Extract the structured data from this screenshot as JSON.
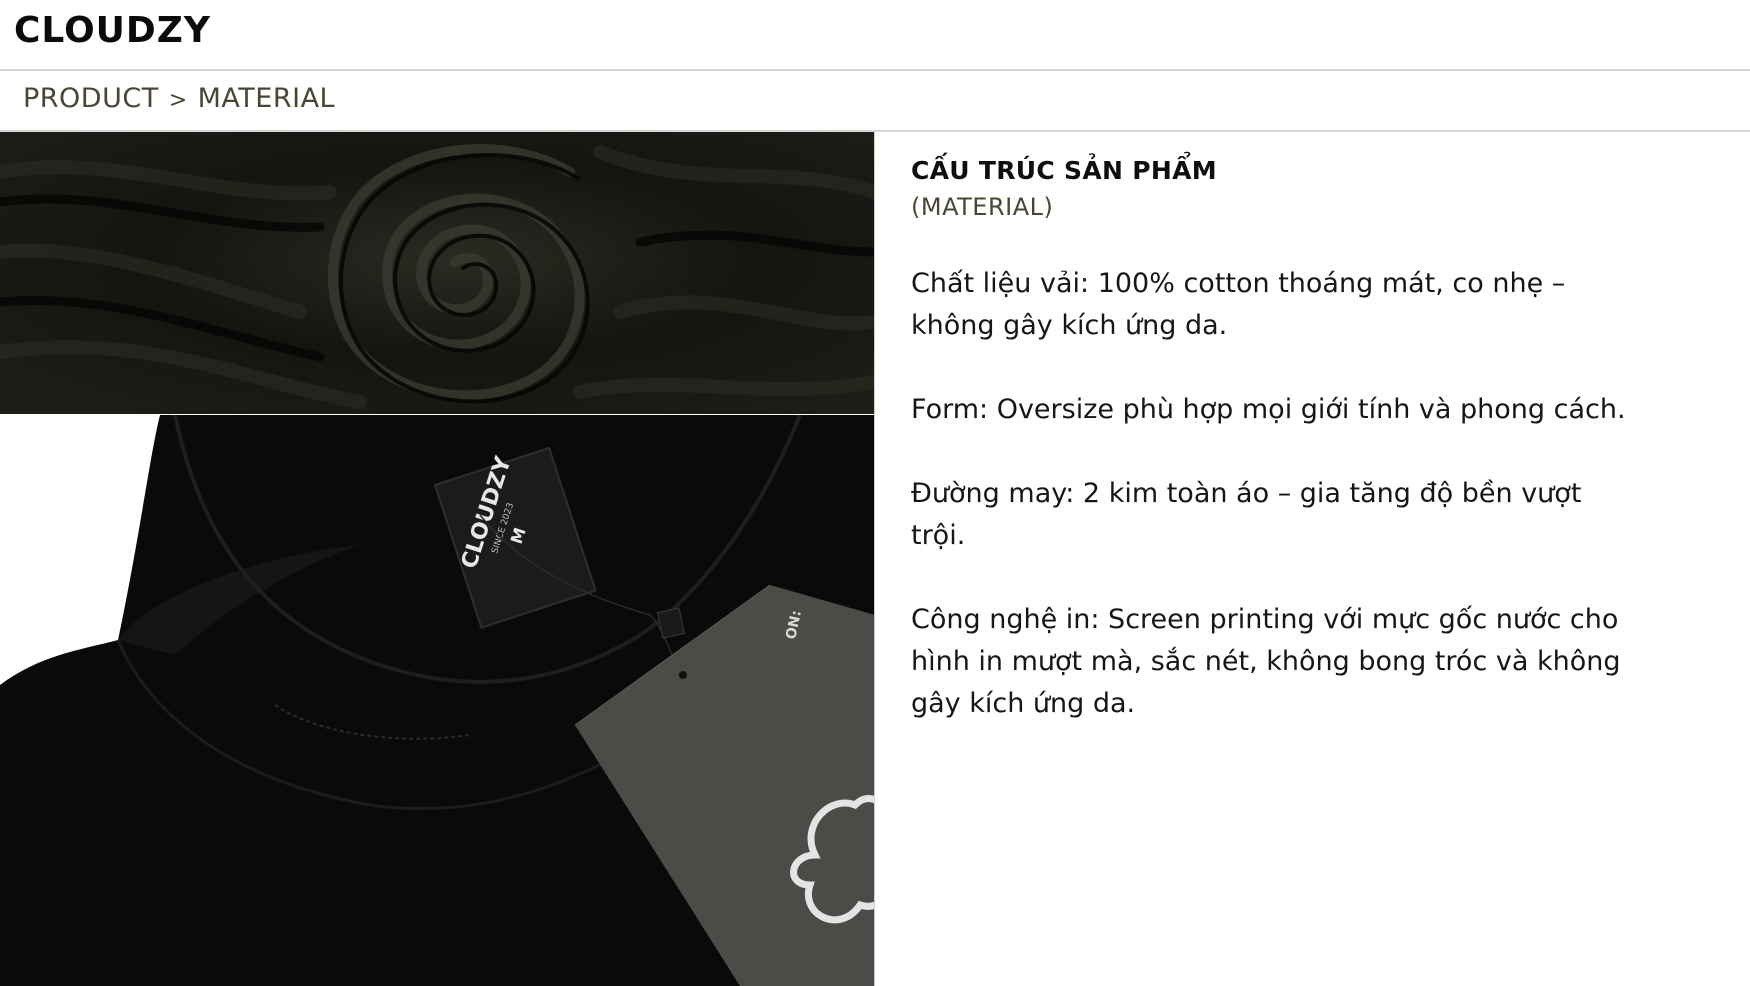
{
  "brand": "CLOUDZY",
  "breadcrumb": {
    "items": [
      "PRODUCT",
      "MATERIAL"
    ],
    "separator": ">"
  },
  "images": {
    "top": {
      "icon": "fabric-swirl-photo"
    },
    "bottom": {
      "icon": "tshirt-collar-photo",
      "label_brand": "CLOUDZY",
      "label_since": "SINCE 2023",
      "label_size": "M"
    }
  },
  "content": {
    "title": "CẤU TRÚC SẢN PHẨM",
    "subtitle": "(MATERIAL)",
    "paragraphs": [
      "Chất liệu vải: 100% cotton thoáng mát, co nhẹ – không gây kích ứng da.",
      "Form: Oversize phù hợp mọi giới tính và phong cách.",
      "Đường may: 2 kim toàn áo – gia tăng độ bền vượt trội.",
      "Công nghệ in: Screen printing với mực gốc nước cho hình in mượt mà, sắc nét, không bong tróc và không gây kích ứng da."
    ]
  },
  "colors": {
    "breadcrumb": "#4a4633",
    "shirt": "#0a0a0a",
    "tag": "#4b4b47"
  }
}
